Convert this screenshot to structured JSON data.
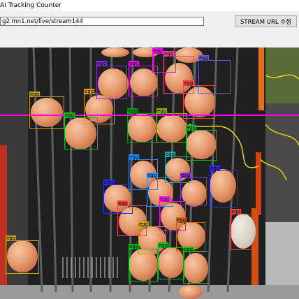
{
  "window": {
    "title": "AI Tracking Counter"
  },
  "toolbar": {
    "stream_url": "g2.mn1.net/live/stream144",
    "stream_button": "STREAM URL 수정"
  },
  "video": {
    "count_line_color": "#ff00e6",
    "detection_label": "egg",
    "box_colors": [
      "#c8a000",
      "#2b2bff",
      "#00c000",
      "#8a2be2",
      "#e0a000",
      "#1e90ff",
      "#ff4040",
      "#ff00ff",
      "#008b8b",
      "#cc6600",
      "#6a5acd",
      "#20b2aa"
    ]
  }
}
